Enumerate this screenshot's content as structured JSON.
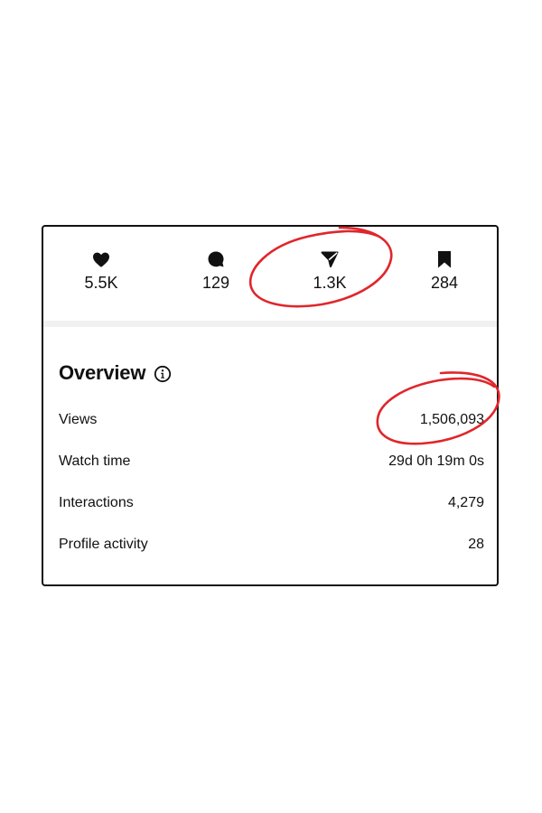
{
  "stats": {
    "likes": {
      "icon": "heart-icon",
      "count": "5.5K"
    },
    "comments": {
      "icon": "comment-bubble-icon",
      "count": "129"
    },
    "shares": {
      "icon": "send-icon",
      "count": "1.3K"
    },
    "saves": {
      "icon": "bookmark-icon",
      "count": "284"
    }
  },
  "overview": {
    "title": "Overview",
    "info_icon": "info-icon",
    "metrics": [
      {
        "label": "Views",
        "value": "1,506,093"
      },
      {
        "label": "Watch time",
        "value": "29d 0h 19m 0s"
      },
      {
        "label": "Interactions",
        "value": "4,279"
      },
      {
        "label": "Profile activity",
        "value": "28"
      }
    ]
  },
  "colors": {
    "text": "#111111",
    "border": "#111111",
    "band": "#f1f1f1",
    "annotation": "#e0262b"
  }
}
